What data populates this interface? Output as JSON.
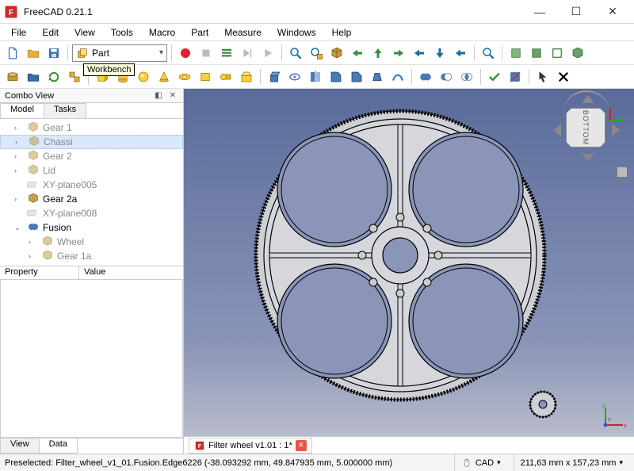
{
  "app": {
    "title": "FreeCAD 0.21.1"
  },
  "window_buttons": {
    "min": "—",
    "max": "☐",
    "close": "✕"
  },
  "menu": [
    "File",
    "Edit",
    "View",
    "Tools",
    "Macro",
    "Part",
    "Measure",
    "Windows",
    "Help"
  ],
  "workbench": {
    "label": "Part",
    "tooltip": "Workbench"
  },
  "combo_view": {
    "title": "Combo View",
    "tabs": [
      "Model",
      "Tasks"
    ],
    "active_tab": 0,
    "tree": [
      {
        "level": 1,
        "expander": "›",
        "icon": "part",
        "label": "Gear 1",
        "selected": false,
        "muted": true
      },
      {
        "level": 1,
        "expander": "›",
        "icon": "part",
        "label": "Chassi",
        "selected": true,
        "muted": true
      },
      {
        "level": 1,
        "expander": "›",
        "icon": "part",
        "label": "Gear 2",
        "selected": false,
        "muted": true
      },
      {
        "level": 1,
        "expander": "›",
        "icon": "part",
        "label": "Lid",
        "selected": false,
        "muted": true
      },
      {
        "level": 1,
        "expander": "",
        "icon": "plane",
        "label": "XY-plane005",
        "selected": false,
        "muted": true
      },
      {
        "level": 1,
        "expander": "›",
        "icon": "part",
        "label": "Gear 2a",
        "selected": false,
        "muted": false
      },
      {
        "level": 1,
        "expander": "",
        "icon": "plane",
        "label": "XY-plane008",
        "selected": false,
        "muted": true
      },
      {
        "level": 1,
        "expander": "⌄",
        "icon": "fusion",
        "label": "Fusion",
        "selected": false,
        "muted": false
      },
      {
        "level": 2,
        "expander": "›",
        "icon": "part",
        "label": "Wheel",
        "selected": false,
        "muted": true
      },
      {
        "level": 2,
        "expander": "›",
        "icon": "part",
        "label": "Gear 1a",
        "selected": false,
        "muted": true
      }
    ],
    "properties": {
      "columns": [
        "Property",
        "Value"
      ]
    },
    "bottom_tabs": [
      "View",
      "Data"
    ],
    "bottom_active": 1
  },
  "navcube": {
    "face": "BOTTOM"
  },
  "document_tabs": [
    {
      "label": "Filter wheel v1.01 : 1*",
      "closable": true
    }
  ],
  "statusbar": {
    "preselect": "Preselected: Filter_wheel_v1_01.Fusion.Edge6226 (-38.093292 mm, 49.847935 mm, 5.000000 mm)",
    "mode": "CAD",
    "dims": "211,63 mm x 157,23 mm"
  },
  "toolbar1_icons": [
    "new-file",
    "open-file",
    "save-file",
    "sep",
    "workbench-combo",
    "sep",
    "macro-record",
    "macro-stop",
    "macros",
    "macro-step",
    "macro-play",
    "sep",
    "fit-all",
    "fit-selection",
    "isometric",
    "front",
    "top",
    "right",
    "rear",
    "bottom",
    "left",
    "sep",
    "measure",
    "sep",
    "box-primitive",
    "shape-primitive",
    "cut-boolean",
    "perspective"
  ],
  "toolbar2_icons": [
    "tree-sync",
    "folder",
    "refresh",
    "link-group",
    "sep",
    "cube",
    "cylinder",
    "sphere",
    "cone",
    "torus",
    "prism",
    "wedge",
    "sep",
    "extrude",
    "revolve",
    "mirror",
    "fillet",
    "chamfer",
    "loft",
    "sep",
    "boolean-union",
    "boolean-cut",
    "boolean-common",
    "sep",
    "check",
    "sep",
    "cursor",
    "snap",
    "x-mark"
  ]
}
